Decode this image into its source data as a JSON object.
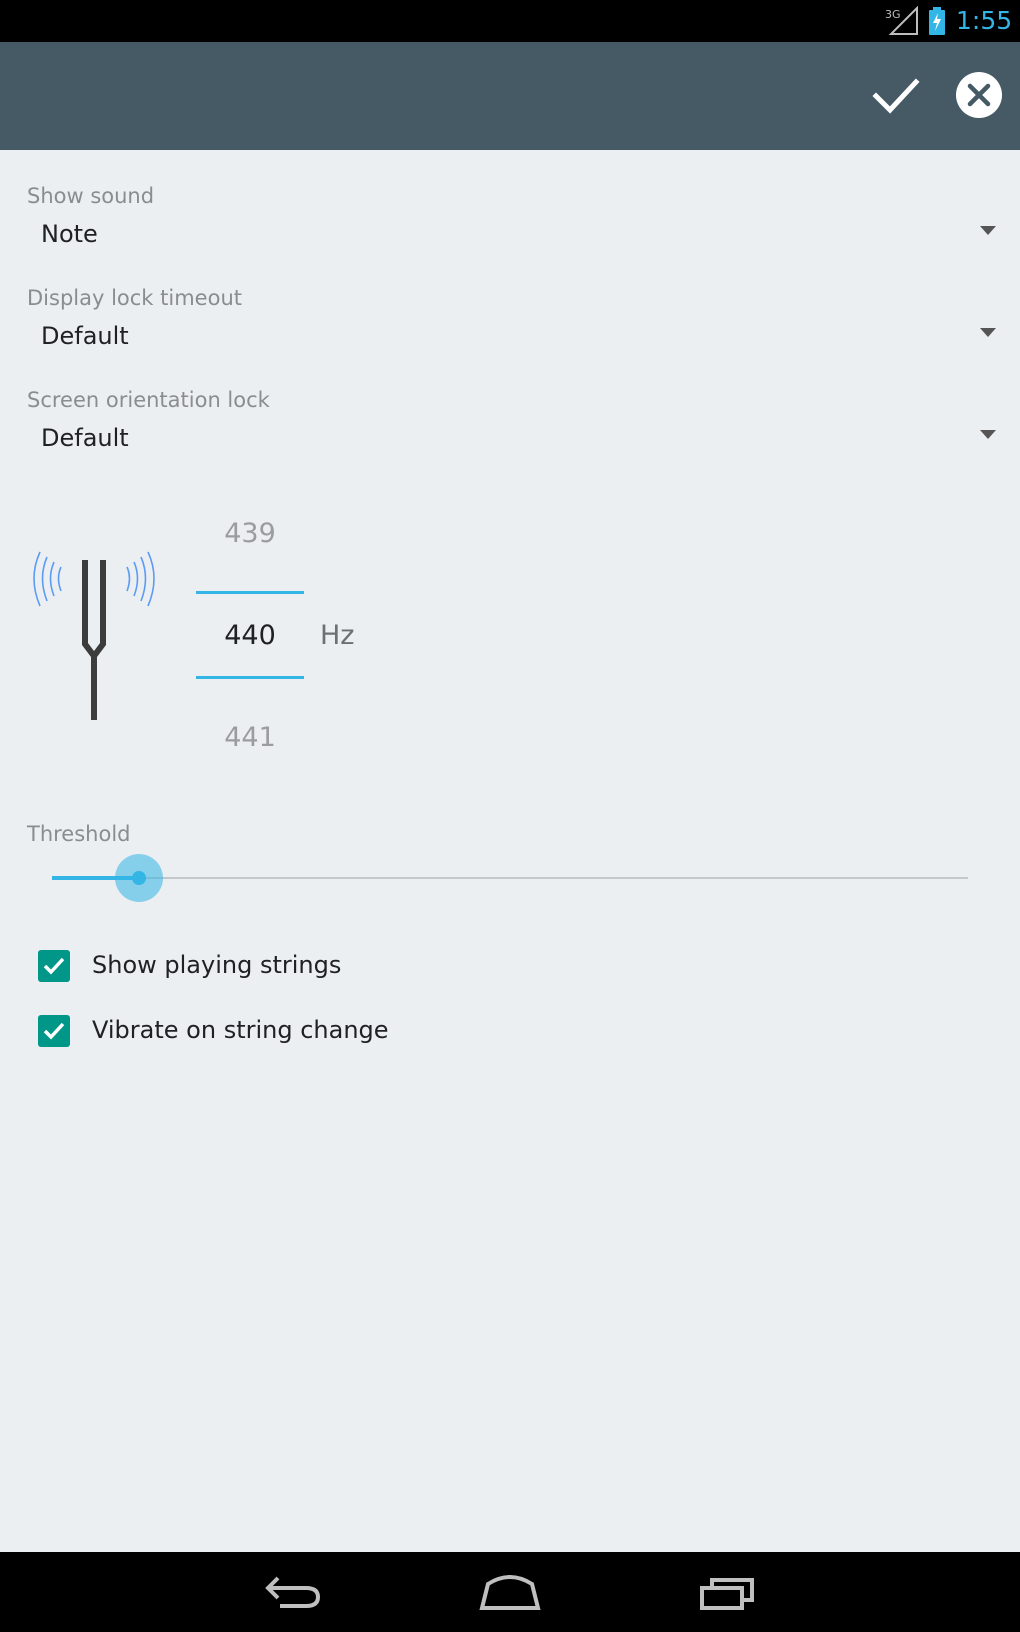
{
  "status_bar": {
    "network_label": "3G",
    "network_icon": "signal-3g-icon",
    "battery_icon": "battery-charging-icon",
    "time": "1:55",
    "time_color": "#33b5e5"
  },
  "action_bar": {
    "background_color": "#455a64",
    "done_icon": "checkmark-icon",
    "cancel_icon": "close-circle-icon"
  },
  "settings": [
    {
      "label": "Show sound",
      "value": "Note"
    },
    {
      "label": "Display lock timeout",
      "value": "Default"
    },
    {
      "label": "Screen orientation lock",
      "value": "Default"
    }
  ],
  "frequency": {
    "icon": "tuning-fork-icon",
    "previous": "439",
    "current": "440",
    "next": "441",
    "unit": "Hz"
  },
  "threshold": {
    "label": "Threshold",
    "value_fraction": 0.095,
    "accent_color": "#33b5e5"
  },
  "checkboxes": [
    {
      "label": "Show playing strings",
      "checked": true
    },
    {
      "label": "Vibrate on string change",
      "checked": true
    }
  ],
  "checkbox_color": "#009688",
  "navigation": {
    "back_icon": "back-icon",
    "home_icon": "home-icon",
    "recents_icon": "recent-apps-icon"
  }
}
